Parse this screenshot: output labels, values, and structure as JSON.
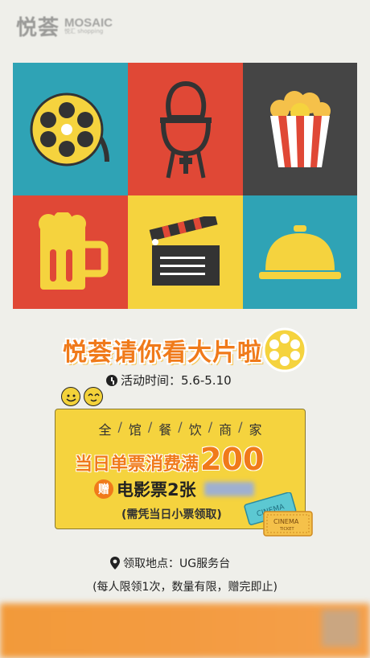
{
  "logo": {
    "cn": "悦荟",
    "en": "MOSAIC",
    "sub": "悦汇 shopping"
  },
  "title": "悦荟请你看大片啦",
  "time": {
    "label": "活动时间：5.6-5.10"
  },
  "panel": {
    "stores": [
      "全",
      "馆",
      "餐",
      "饮",
      "商",
      "家"
    ],
    "spend_text": "当日单票消费满",
    "spend_amount": "200",
    "gift_badge": "赠",
    "gift_text": "电影票2张",
    "note": "(需凭当日小票领取)"
  },
  "ticket": {
    "front": "CINEMA",
    "front_sub": "TICKET",
    "back": "CINEMA"
  },
  "location": "领取地点：UG服务台",
  "limit": "(每人限领1次，数量有限，赠完即止)",
  "colors": {
    "teal": "#2fa3b5",
    "red": "#e04836",
    "dark": "#4a4a4a",
    "yellow": "#f5d33e",
    "orange": "#f07a1a"
  },
  "icons": [
    "film-reel-icon",
    "bbq-grill-icon",
    "popcorn-icon",
    "beer-mug-icon",
    "clapperboard-icon",
    "cloche-icon"
  ]
}
